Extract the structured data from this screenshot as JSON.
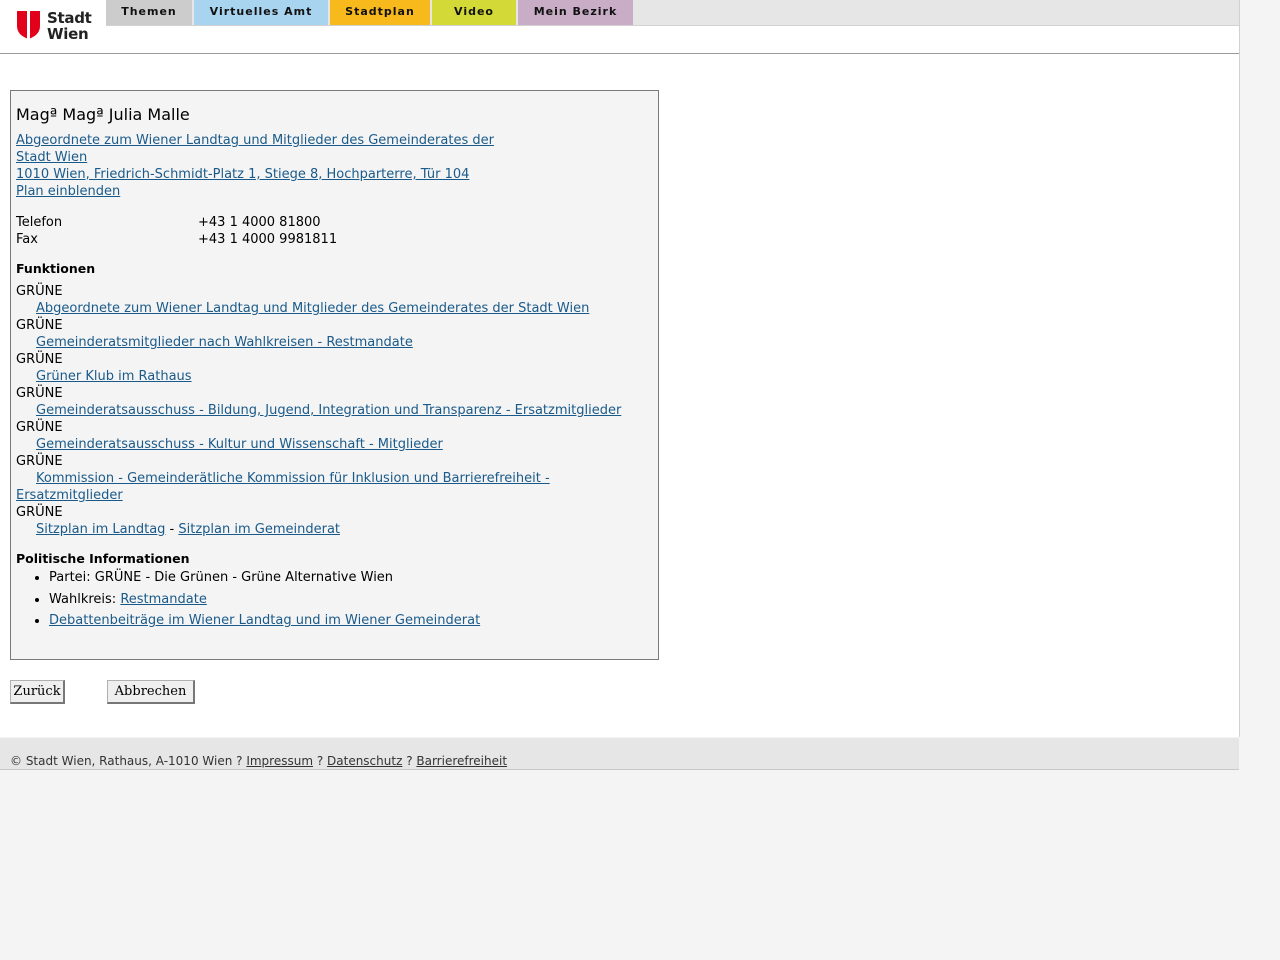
{
  "brand": {
    "logo_line1": "Stadt",
    "logo_line2": "Wien",
    "accent": "#e2001a"
  },
  "nav": {
    "tabs": [
      {
        "label": "Themen",
        "color": "#cccccc"
      },
      {
        "label": "Virtuelles Amt",
        "color": "#a9d4ef"
      },
      {
        "label": "Stadtplan",
        "color": "#f7b91c"
      },
      {
        "label": "Video",
        "color": "#d3d936"
      },
      {
        "label": "Mein Bezirk",
        "color": "#c9adc7"
      }
    ]
  },
  "person": {
    "name": "Magª Magª Julia Malle",
    "org_line1": "Abgeordnete zum Wiener Landtag und Mitglieder des Gemeinderates der",
    "org_line2": "Stadt Wien ",
    "address": "1010 Wien, Friedrich-Schmidt-Platz 1, Stiege 8, Hochparterre, Tür 104",
    "plan_link": "Plan einblenden",
    "phone_label": "Telefon",
    "phone": "+43 1 4000 81800",
    "fax_label": "Fax",
    "fax": "+43 1 4000 9981811"
  },
  "functions": {
    "title": "Funktionen",
    "items": [
      {
        "party": "GRÜNE",
        "link": "Abgeordnete zum Wiener Landtag und Mitglieder des Gemeinderates der Stadt Wien"
      },
      {
        "party": "GRÜNE",
        "link": "Gemeinderatsmitglieder nach Wahlkreisen - Restmandate"
      },
      {
        "party": "GRÜNE",
        "link": "Grüner Klub im Rathaus"
      },
      {
        "party": "GRÜNE",
        "link": "Gemeinderatsausschuss - Bildung, Jugend, Integration und Transparenz - Ersatzmitglieder"
      },
      {
        "party": "GRÜNE",
        "link": "Gemeinderatsausschuss - Kultur und Wissenschaft - Mitglieder"
      },
      {
        "party": "GRÜNE",
        "link": "Kommission - Gemeinderätliche Kommission für Inklusion und Barrierefreiheit - Ersatzmitglieder"
      }
    ],
    "last": {
      "party": "GRÜNE",
      "link1": "Sitzplan im Landtag",
      "sep": " - ",
      "link2": "Sitzplan im Gemeinderat"
    }
  },
  "political": {
    "title": "Politische Informationen",
    "partei": "Partei: GRÜNE - Die Grünen - Grüne Alternative Wien",
    "wahlkreis_label": "Wahlkreis: ",
    "wahlkreis_link": "Restmandate",
    "debatten_link": "Debattenbeiträge im Wiener Landtag und im Wiener Gemeinderat"
  },
  "buttons": {
    "back": "Zurück",
    "cancel": "Abbrechen"
  },
  "footer": {
    "copyright": "© Stadt Wien, Rathaus, A-1010 Wien ? ",
    "impressum": "Impressum",
    "sep1": " ? ",
    "datenschutz": "Datenschutz",
    "sep2": " ? ",
    "barrierefreiheit": "Barrierefreiheit"
  }
}
